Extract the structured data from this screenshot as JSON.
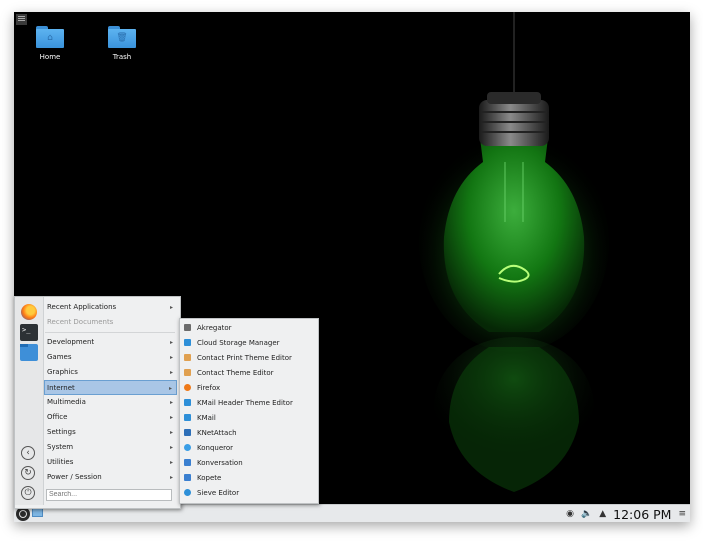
{
  "desktop": {
    "icons": [
      {
        "label": "Home",
        "glyph": "⌂",
        "icon": "home-folder-icon"
      },
      {
        "label": "Trash",
        "glyph": "🗑",
        "icon": "trash-folder-icon"
      }
    ]
  },
  "menu": {
    "items": [
      {
        "label": "Recent Applications",
        "submenu": true
      },
      {
        "label": "Recent Documents",
        "submenu": false,
        "disabled": true
      },
      {
        "label": "Development",
        "submenu": true
      },
      {
        "label": "Games",
        "submenu": true
      },
      {
        "label": "Graphics",
        "submenu": true
      },
      {
        "label": "Internet",
        "submenu": true,
        "active": true
      },
      {
        "label": "Multimedia",
        "submenu": true
      },
      {
        "label": "Office",
        "submenu": true
      },
      {
        "label": "Settings",
        "submenu": true
      },
      {
        "label": "System",
        "submenu": true
      },
      {
        "label": "Utilities",
        "submenu": true
      },
      {
        "label": "Power / Session",
        "submenu": true
      }
    ],
    "arrow": "▸",
    "search_placeholder": "Search...",
    "favorites": [
      "firefox-icon",
      "terminal-icon",
      "file-manager-icon"
    ],
    "side_buttons": [
      "back-icon",
      "refresh-icon",
      "power-icon"
    ]
  },
  "submenu": {
    "items": [
      {
        "label": "Akregator",
        "icon_color": "#6b6b6b"
      },
      {
        "label": "Cloud Storage Manager",
        "icon_color": "#2d8fd8"
      },
      {
        "label": "Contact Print Theme Editor",
        "icon_color": "#e0a050"
      },
      {
        "label": "Contact Theme Editor",
        "icon_color": "#e0a050"
      },
      {
        "label": "Firefox",
        "icon_color": "#ef7a1a"
      },
      {
        "label": "KMail Header Theme Editor",
        "icon_color": "#2d8fd8"
      },
      {
        "label": "KMail",
        "icon_color": "#2d8fd8"
      },
      {
        "label": "KNetAttach",
        "icon_color": "#2d6fb8"
      },
      {
        "label": "Konqueror",
        "icon_color": "#3a9ee6"
      },
      {
        "label": "Konversation",
        "icon_color": "#3a7fd0"
      },
      {
        "label": "Kopete",
        "icon_color": "#3a7fd0"
      },
      {
        "label": "Sieve Editor",
        "icon_color": "#2d8fd8"
      }
    ]
  },
  "panel": {
    "clock": "12:06 PM"
  },
  "colors": {
    "desktop_bg": "#000000",
    "accent": "#a9c6e6",
    "bulb_green": "#3ad13a"
  }
}
